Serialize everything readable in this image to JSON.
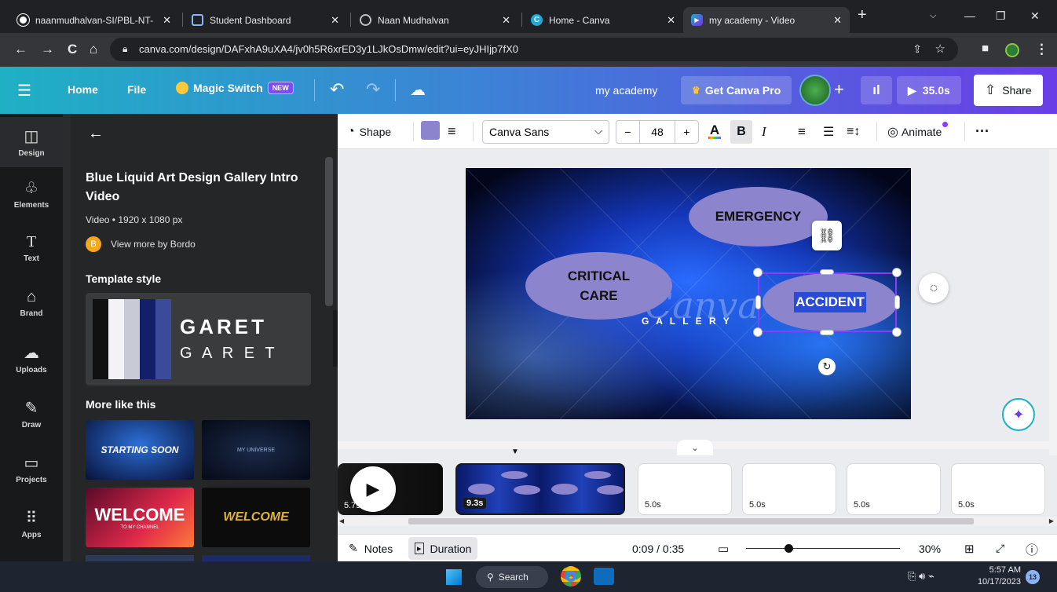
{
  "browser": {
    "tabs": [
      {
        "title": "naanmudhalvan-SI/PBL-NT-",
        "icon": "github-icon"
      },
      {
        "title": "Student Dashboard",
        "icon": "page-icon"
      },
      {
        "title": "Naan Mudhalvan",
        "icon": "globe-icon"
      },
      {
        "title": "Home - Canva",
        "icon": "canva-icon"
      },
      {
        "title": "my academy - Video",
        "icon": "video-icon",
        "active": true
      }
    ],
    "url": "canva.com/design/DAFxhA9uXA4/jv0h5R6xrED3y1LJkOsDmw/edit?ui=eyJHIjp7fX0"
  },
  "header": {
    "home": "Home",
    "file": "File",
    "magic_switch": "Magic Switch",
    "new_badge": "NEW",
    "design_title": "my academy",
    "get_pro": "Get Canva Pro",
    "play_duration": "35.0s",
    "share": "Share"
  },
  "rail": {
    "items": [
      {
        "label": "Design",
        "icon": "design-icon"
      },
      {
        "label": "Elements",
        "icon": "elements-icon"
      },
      {
        "label": "Text",
        "icon": "text-icon"
      },
      {
        "label": "Brand",
        "icon": "brand-icon"
      },
      {
        "label": "Uploads",
        "icon": "uploads-icon"
      },
      {
        "label": "Draw",
        "icon": "draw-icon"
      },
      {
        "label": "Projects",
        "icon": "projects-icon"
      },
      {
        "label": "Apps",
        "icon": "apps-icon"
      }
    ]
  },
  "panel": {
    "title": "Blue Liquid Art Design Gallery Intro Video",
    "meta": "Video • 1920 x 1080 px",
    "author_initial": "B",
    "author_link": "View more by Bordo",
    "template_style_heading": "Template style",
    "style_text_1": "GARET",
    "style_text_2": "G A R E T",
    "more_like_this": "More like this",
    "thumbs": [
      {
        "text": "STARTING SOON"
      },
      {
        "text": "MY UNIVERSE"
      },
      {
        "text": "WELCOME",
        "sub": "TO MY CHANNEL"
      },
      {
        "text": "WELCOME"
      }
    ]
  },
  "toolbar": {
    "shape": "Shape",
    "font": "Canva Sans",
    "font_size": "48",
    "minus": "−",
    "plus": "+",
    "animate": "Animate"
  },
  "design": {
    "emergency": "EMERGENCY",
    "critical_care": "CRITICAL CARE",
    "accident": "ACCIDENT",
    "watermark": "Canva",
    "gallery": "G A L L E R Y"
  },
  "timeline": {
    "clips": [
      {
        "duration": "5.7s"
      },
      {
        "duration": "9.3s"
      },
      {
        "duration": "5.0s"
      },
      {
        "duration": "5.0s"
      },
      {
        "duration": "5.0s"
      },
      {
        "duration": "5.0s"
      }
    ]
  },
  "footer": {
    "notes": "Notes",
    "duration": "Duration",
    "time": "0:09 / 0:35",
    "zoom": "30%",
    "zoom_level": 0.3
  },
  "taskbar": {
    "search": "Search",
    "time": "5:57 AM",
    "date": "10/17/2023",
    "notif": "13"
  }
}
